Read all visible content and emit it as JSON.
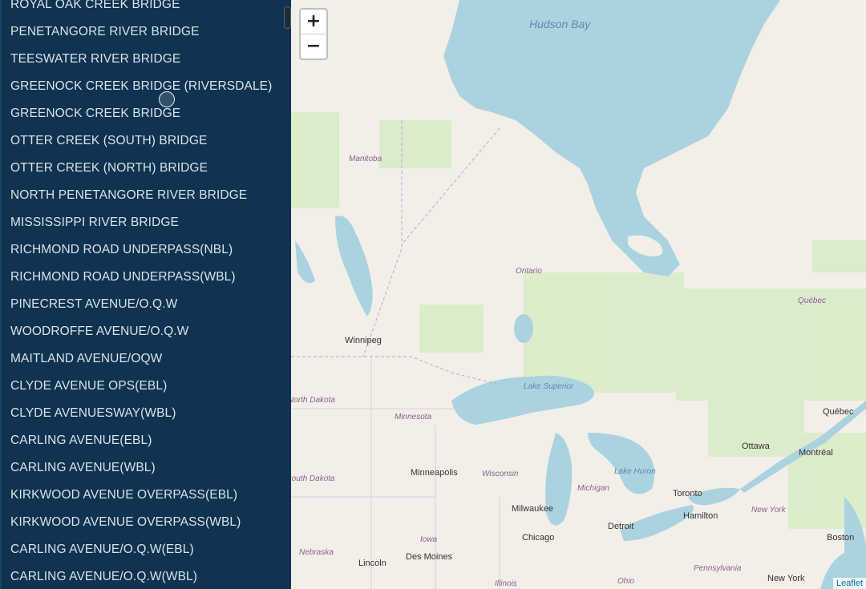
{
  "sidebar": {
    "items": [
      "ROYAL OAK CREEK BRIDGE",
      "PENETANGORE RIVER BRIDGE",
      "TEESWATER RIVER BRIDGE",
      "GREENOCK CREEK BRIDGE (RIVERSDALE)",
      "GREENOCK CREEK BRIDGE",
      "OTTER CREEK (SOUTH) BRIDGE",
      "OTTER CREEK (NORTH) BRIDGE",
      "NORTH PENETANGORE RIVER BRIDGE",
      "MISSISSIPPI RIVER BRIDGE",
      "RICHMOND ROAD UNDERPASS(NBL)",
      "RICHMOND ROAD UNDERPASS(WBL)",
      "PINECREST AVENUE/O.Q.W",
      "WOODROFFE AVENUE/O.Q.W",
      "MAITLAND AVENUE/OQW",
      "CLYDE AVENUE OPS(EBL)",
      "CLYDE AVENUESWAY(WBL)",
      "CARLING AVENUE(EBL)",
      "CARLING AVENUE(WBL)",
      "KIRKWOOD AVENUE OVERPASS(EBL)",
      "KIRKWOOD AVENUE OVERPASS(WBL)",
      "CARLING AVENUE/O.Q.W(EBL)",
      "CARLING AVENUE/O.Q.W(WBL)"
    ]
  },
  "map": {
    "zoom_in": "+",
    "zoom_out": "−",
    "attribution": "Leaflet",
    "water_labels": [
      "Hudson Bay",
      "Lake Superior",
      "Lake Huron"
    ],
    "region_labels": [
      "Manitoba",
      "Ontario",
      "Québec",
      "North Dakota",
      "Minnesota",
      "Wisconsin",
      "Michigan",
      "South Dakota",
      "Iowa",
      "Nebraska",
      "New York",
      "Pennsylvania",
      "Illinois",
      "Ohio"
    ],
    "city_labels": [
      "Winnipeg",
      "Québec",
      "Ottawa",
      "Montréal",
      "Minneapolis",
      "Toronto",
      "Milwaukee",
      "Hamilton",
      "Detroit",
      "Chicago",
      "Boston",
      "Des Moines",
      "Lincoln",
      "New York"
    ]
  },
  "colors": {
    "sidebar_bg": "#0f3350",
    "water": "#aad3df",
    "land": "#f2efe9",
    "forest": "#d8ecc8"
  }
}
